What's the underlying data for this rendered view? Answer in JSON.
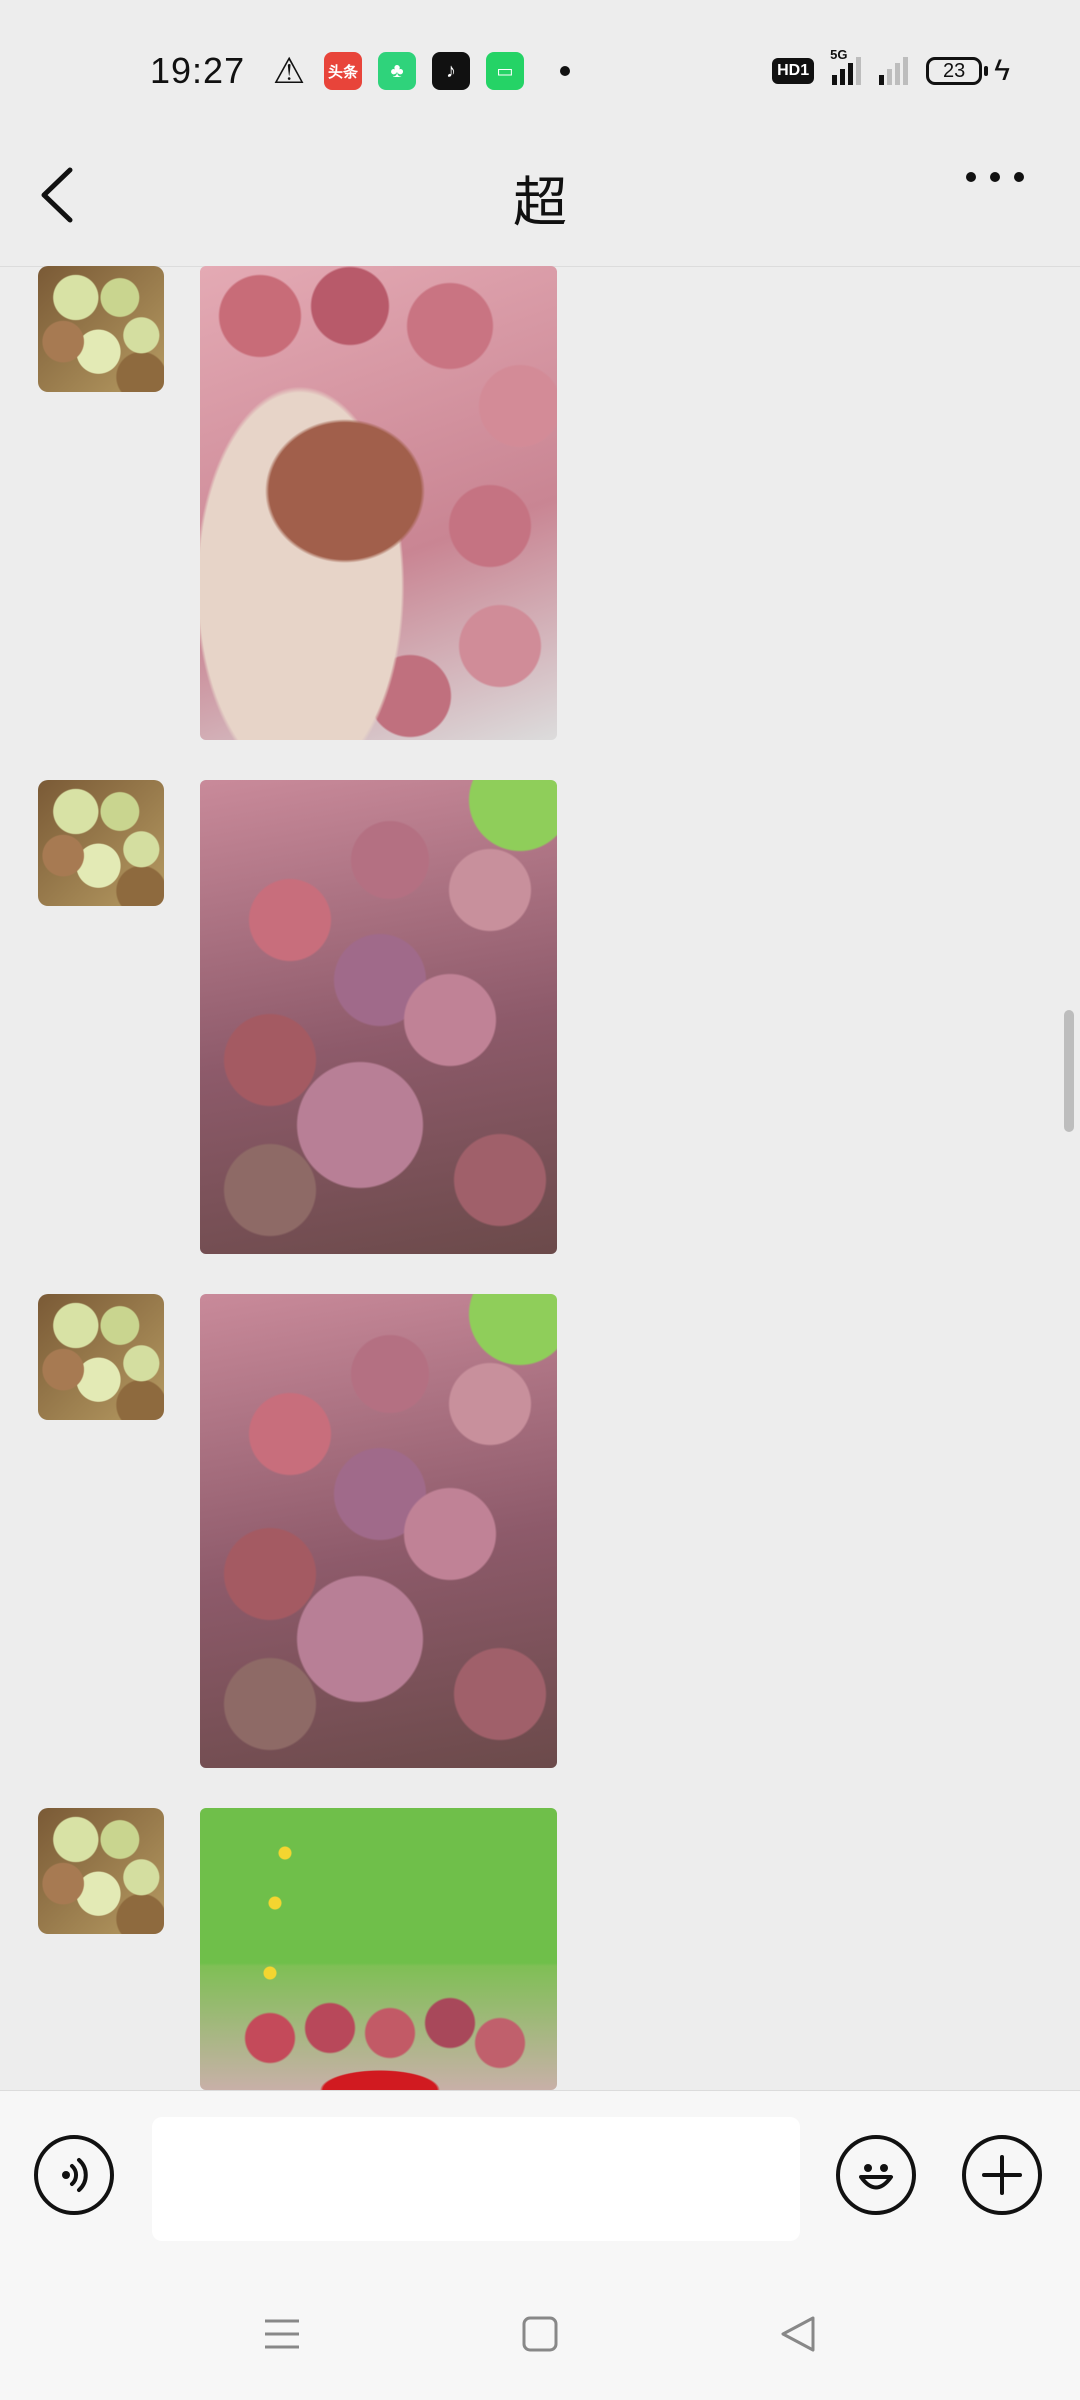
{
  "status_bar": {
    "time": "19:27",
    "notifications": [
      {
        "name": "warning-icon",
        "glyph": "⚠"
      },
      {
        "name": "toutiao-app-icon",
        "glyph": "头条"
      },
      {
        "name": "mini-program-icon",
        "glyph": "♣"
      },
      {
        "name": "tiktok-app-icon",
        "glyph": "♪"
      },
      {
        "name": "chat-app-icon",
        "glyph": "▭"
      }
    ],
    "hd_label": "HD1",
    "network_label": "5G",
    "battery_level": "23"
  },
  "title_bar": {
    "title": "超"
  },
  "messages": [
    {
      "type": "image",
      "sender": "contact",
      "image_name": "plum-in-hand-photo"
    },
    {
      "type": "image",
      "sender": "contact",
      "image_name": "plum-pile-photo"
    },
    {
      "type": "image",
      "sender": "contact",
      "image_name": "plum-pile-photo"
    },
    {
      "type": "image",
      "sender": "contact",
      "image_name": "plums-on-grass-photo"
    }
  ],
  "input_bar": {
    "text_value": "",
    "placeholder": ""
  },
  "icons": {
    "back": "back-arrow-icon",
    "more": "more-dots-icon",
    "voice": "voice-icon",
    "emoji": "emoji-icon",
    "plus": "plus-icon",
    "nav_menu": "menu-icon",
    "nav_home": "home-icon",
    "nav_back": "nav-back-icon"
  }
}
